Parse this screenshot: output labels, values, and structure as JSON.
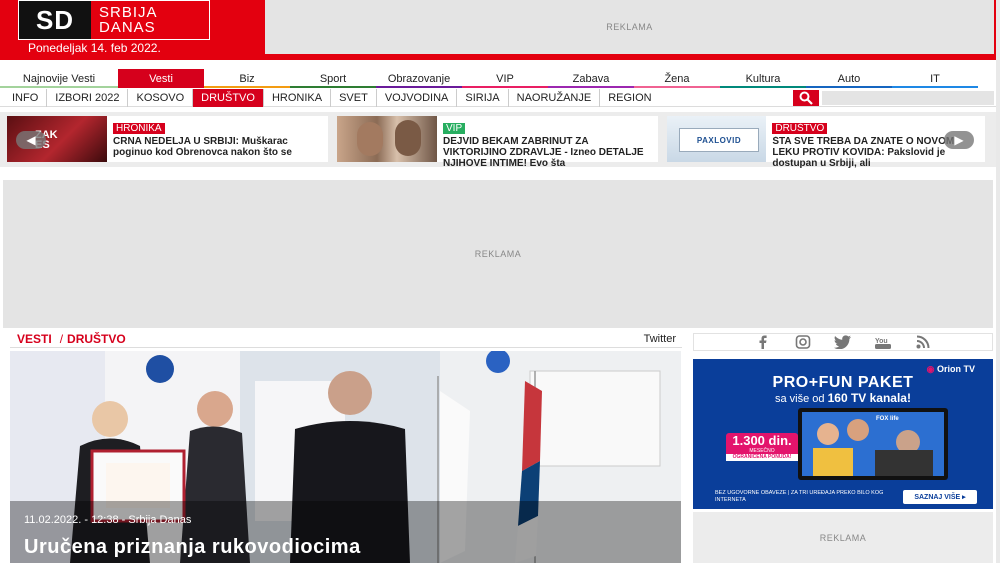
{
  "header": {
    "logo_sd": "SD",
    "logo_line1": "SRBIJA",
    "logo_line2": "DANAS",
    "date": "Ponedeljak 14. feb 2022.",
    "ad_label": "REKLAMA"
  },
  "main_nav": [
    {
      "label": "Najnovije Vesti",
      "color": "#a3d39c"
    },
    {
      "label": "Vesti",
      "color": "#d6001c",
      "active": true
    },
    {
      "label": "Biz",
      "color": "#f39c12"
    },
    {
      "label": "Sport",
      "color": "#2e7d32"
    },
    {
      "label": "Obrazovanje",
      "color": "#6a1b9a"
    },
    {
      "label": "VIP",
      "color": "#e91e63"
    },
    {
      "label": "Zabava",
      "color": "#9c27b0"
    },
    {
      "label": "Žena",
      "color": "#f06292"
    },
    {
      "label": "Kultura",
      "color": "#00897b"
    },
    {
      "label": "Auto",
      "color": "#1565c0"
    },
    {
      "label": "IT",
      "color": "#1e88e5"
    }
  ],
  "sub_nav": [
    {
      "label": "INFO"
    },
    {
      "label": "IZBORI 2022"
    },
    {
      "label": "KOSOVO"
    },
    {
      "label": "DRUŠTVO",
      "active": true
    },
    {
      "label": "HRONIKA"
    },
    {
      "label": "SVET"
    },
    {
      "label": "VOJVODINA"
    },
    {
      "label": "SIRIJA"
    },
    {
      "label": "NAORUŽANJE"
    },
    {
      "label": "REGION"
    }
  ],
  "featured": [
    {
      "category": "HRONIKA",
      "title": "CRNA NEDELJA U SRBIJI: Muškarac poginuo kod Obrenovca nakon što se",
      "thumb_text": "ZAK\nES"
    },
    {
      "category": "VIP",
      "title": "DEJVID BEKAM ZABRINUT ZA VIKTORIJINO ZDRAVLJE - Izneo DETALJE NJIHOVE INTIME! Evo šta",
      "thumb_text": ""
    },
    {
      "category": "DRUŠTVO",
      "title": "ŠTA SVE TREBA DA ZNATE O NOVOM LEKU PROTIV KOVIDA: Pakslovid je dostupan u Srbiji, ali",
      "thumb_text": "PAXLOVID"
    }
  ],
  "big_ad": {
    "label": "REKLAMA"
  },
  "breadcrumb": {
    "level1": "VESTI",
    "separator": "/",
    "level2": "DRUŠTVO",
    "twitter": "Twitter"
  },
  "hero": {
    "meta": "11.02.2022. - 12:38 - Srbija Danas",
    "title": "Uručena priznanja rukovodiocima"
  },
  "social_icons": [
    "facebook-icon",
    "instagram-icon",
    "twitter-icon",
    "youtube-icon",
    "rss-icon"
  ],
  "promo": {
    "brand": "Orion TV",
    "headline": "PRO+FUN PAKET",
    "sub_pre": "sa više od ",
    "sub_bold": "160 TV kanala!",
    "price": "1.300 din.",
    "price_note": "MESEČNO",
    "price_offer": "OGRANIČENA PONUDA!",
    "fine_print": "BEZ UGOVORNE OBAVEZE | ZA TRI UREĐAJA PREKO BILO KOG INTERNETA",
    "cta": "SAZNAJ VIŠE ▸"
  },
  "side_ad": {
    "label": "REKLAMA"
  }
}
